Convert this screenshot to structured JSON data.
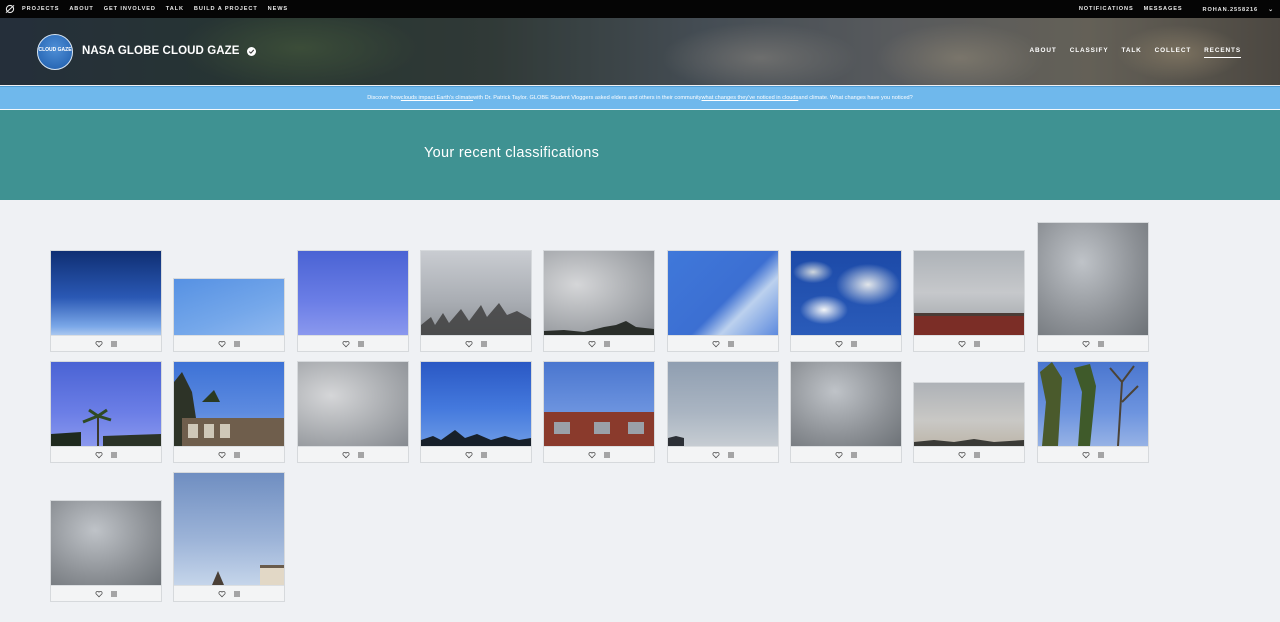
{
  "topnav": {
    "left": [
      "PROJECTS",
      "ABOUT",
      "GET INVOLVED",
      "TALK",
      "BUILD A PROJECT",
      "NEWS"
    ],
    "right": [
      "NOTIFICATIONS",
      "MESSAGES",
      "ROHAN.2558216"
    ]
  },
  "project": {
    "title": "NASA GLOBE CLOUD GAZE",
    "avatar_text": "CLOUD GAZE",
    "nav": [
      "ABOUT",
      "CLASSIFY",
      "TALK",
      "COLLECT",
      "RECENTS"
    ],
    "active_nav": "RECENTS"
  },
  "banner": {
    "part1": "Discover how ",
    "link1": "clouds impact Earth's climate",
    "part2": " with Dr. Patrick Taylor. GLOBE Student Vloggers asked elders and others in their community ",
    "link2": "what changes they've noticed in clouds",
    "part3": " and climate. What changes have you noticed?"
  },
  "page": {
    "title": "Your recent classifications"
  },
  "colors": {
    "topnav_bg": "#050505",
    "banner_bg": "#6fb8ec",
    "title_band_bg": "#3f9292",
    "page_bg": "#eff1f4"
  },
  "icons": {
    "favorite": "heart-icon",
    "collect": "list-icon"
  }
}
